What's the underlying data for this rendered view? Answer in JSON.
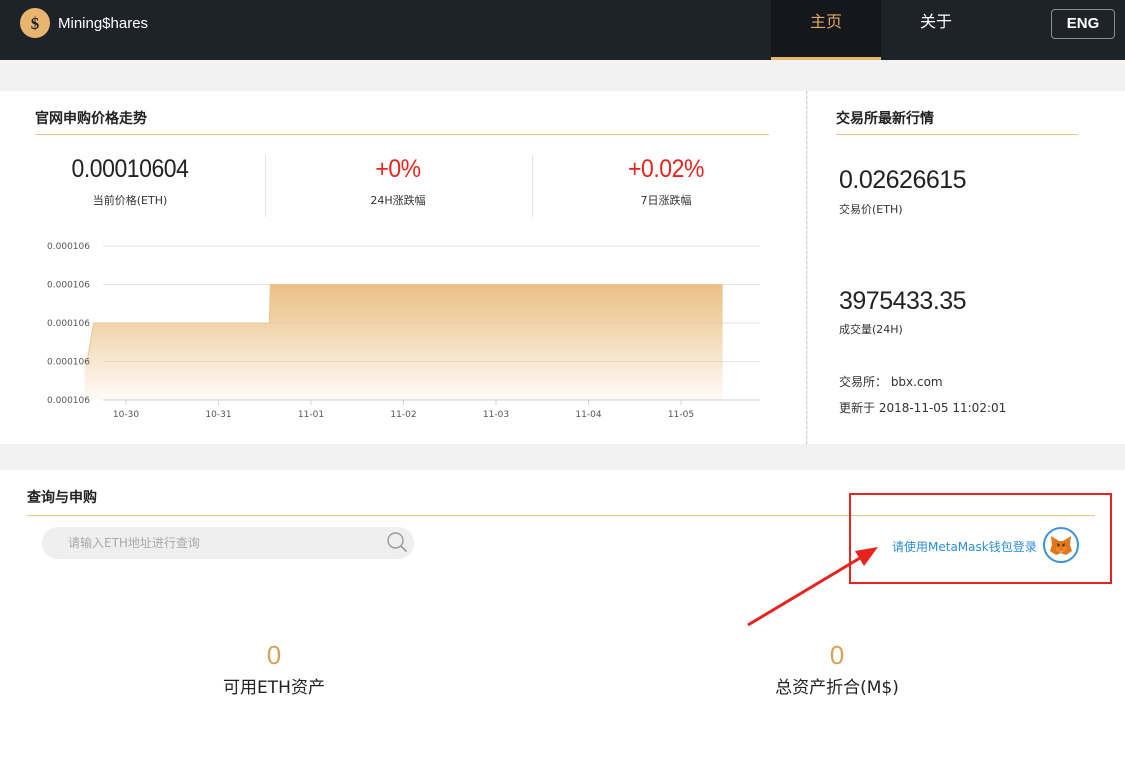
{
  "header": {
    "logo_text": "Mining$hares",
    "nav": [
      {
        "label": "主页",
        "active": true
      },
      {
        "label": "关于",
        "active": false
      }
    ],
    "lang": "ENG"
  },
  "price_panel": {
    "title": "官网申购价格走势",
    "stats": [
      {
        "value": "0.00010604",
        "label": "当前价格(ETH)"
      },
      {
        "value": "+0%",
        "label": "24H涨跌幅"
      },
      {
        "value": "+0.02%",
        "label": "7日涨跌幅"
      }
    ]
  },
  "market_panel": {
    "title": "交易所最新行情",
    "price": "0.02626615",
    "price_label": "交易价(ETH)",
    "volume": "3975433.35",
    "volume_label": "成交量(24H)",
    "exchange": "交易所： bbx.com",
    "updated": "更新于 2018-11-05 11:02:01"
  },
  "query_panel": {
    "title": "查询与申购",
    "search_placeholder": "请输入ETH地址进行查询",
    "login_text": "请使用MetaMask钱包登录",
    "assets": [
      {
        "value": "0",
        "label": "可用ETH资产"
      },
      {
        "value": "0",
        "label": "总资产折合(M$)"
      }
    ]
  },
  "colors": {
    "accent": "#e8b46e",
    "red": "#e8231e",
    "header": "#1e232a",
    "link": "#2b8ee0"
  },
  "chart_data": {
    "type": "area",
    "categories": [
      "10-30",
      "10-31",
      "11-01",
      "11-02",
      "11-03",
      "11-04",
      "11-05"
    ],
    "ytick_labels": [
      "0.000106",
      "0.000106",
      "0.000106",
      "0.000106",
      "0.000106"
    ],
    "x": [
      -0.45,
      -0.42,
      -0.35,
      0.55,
      1.55,
      1.56,
      2.5,
      3.5,
      4.5,
      5.5,
      6.45
    ],
    "values": [
      0.00010598,
      0.00010598,
      0.00010601,
      0.00010601,
      0.00010601,
      0.00010604,
      0.00010604,
      0.00010604,
      0.00010604,
      0.00010604,
      0.00010604
    ],
    "ylim": [
      0.00010595,
      0.00010607
    ],
    "grid": true,
    "fill_color": "#e8b46e"
  }
}
